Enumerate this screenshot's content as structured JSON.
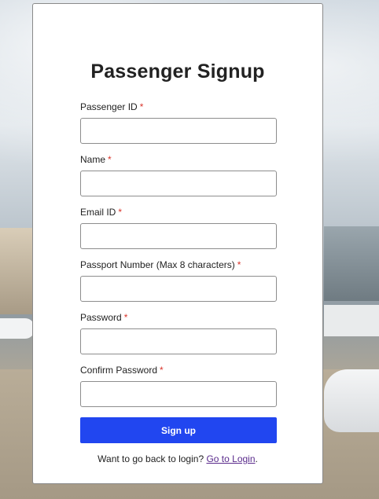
{
  "form": {
    "title": "Passenger Signup",
    "fields": [
      {
        "label": "Passenger ID",
        "required": "*",
        "value": "",
        "placeholder": ""
      },
      {
        "label": "Name",
        "required": "*",
        "value": "",
        "placeholder": ""
      },
      {
        "label": "Email ID",
        "required": "*",
        "value": "",
        "placeholder": ""
      },
      {
        "label": "Passport Number (Max 8 characters)",
        "required": "*",
        "value": "",
        "placeholder": ""
      },
      {
        "label": "Password",
        "required": "*",
        "value": "",
        "placeholder": ""
      },
      {
        "label": "Confirm Password",
        "required": "*",
        "value": "",
        "placeholder": ""
      }
    ],
    "submit_label": "Sign up",
    "login_prompt": "Want to go back to login?",
    "login_link": "Go to Login",
    "login_suffix": "."
  },
  "colors": {
    "accent": "#2146f0",
    "required": "#d9342b",
    "link": "#5a2b8c"
  }
}
